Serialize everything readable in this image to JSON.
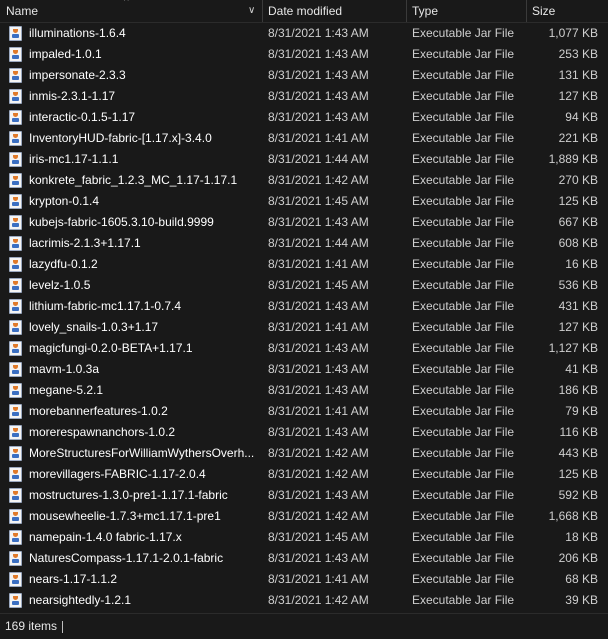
{
  "header": {
    "name_label": "Name",
    "date_label": "Date modified",
    "type_label": "Type",
    "size_label": "Size",
    "sort_icon": "^",
    "chevron_icon": "∨"
  },
  "files": [
    {
      "name": "illuminations-1.6.4",
      "date": "8/31/2021 1:43 AM",
      "type": "Executable Jar File",
      "size": "1,077 KB"
    },
    {
      "name": "impaled-1.0.1",
      "date": "8/31/2021 1:43 AM",
      "type": "Executable Jar File",
      "size": "253 KB"
    },
    {
      "name": "impersonate-2.3.3",
      "date": "8/31/2021 1:43 AM",
      "type": "Executable Jar File",
      "size": "131 KB"
    },
    {
      "name": "inmis-2.3.1-1.17",
      "date": "8/31/2021 1:43 AM",
      "type": "Executable Jar File",
      "size": "127 KB"
    },
    {
      "name": "interactic-0.1.5-1.17",
      "date": "8/31/2021 1:43 AM",
      "type": "Executable Jar File",
      "size": "94 KB"
    },
    {
      "name": "InventoryHUD-fabric-[1.17.x]-3.4.0",
      "date": "8/31/2021 1:41 AM",
      "type": "Executable Jar File",
      "size": "221 KB"
    },
    {
      "name": "iris-mc1.17-1.1.1",
      "date": "8/31/2021 1:44 AM",
      "type": "Executable Jar File",
      "size": "1,889 KB"
    },
    {
      "name": "konkrete_fabric_1.2.3_MC_1.17-1.17.1",
      "date": "8/31/2021 1:42 AM",
      "type": "Executable Jar File",
      "size": "270 KB"
    },
    {
      "name": "krypton-0.1.4",
      "date": "8/31/2021 1:45 AM",
      "type": "Executable Jar File",
      "size": "125 KB"
    },
    {
      "name": "kubejs-fabric-1605.3.10-build.9999",
      "date": "8/31/2021 1:43 AM",
      "type": "Executable Jar File",
      "size": "667 KB"
    },
    {
      "name": "lacrimis-2.1.3+1.17.1",
      "date": "8/31/2021 1:44 AM",
      "type": "Executable Jar File",
      "size": "608 KB"
    },
    {
      "name": "lazydfu-0.1.2",
      "date": "8/31/2021 1:41 AM",
      "type": "Executable Jar File",
      "size": "16 KB"
    },
    {
      "name": "levelz-1.0.5",
      "date": "8/31/2021 1:45 AM",
      "type": "Executable Jar File",
      "size": "536 KB"
    },
    {
      "name": "lithium-fabric-mc1.17.1-0.7.4",
      "date": "8/31/2021 1:43 AM",
      "type": "Executable Jar File",
      "size": "431 KB"
    },
    {
      "name": "lovely_snails-1.0.3+1.17",
      "date": "8/31/2021 1:41 AM",
      "type": "Executable Jar File",
      "size": "127 KB"
    },
    {
      "name": "magicfungi-0.2.0-BETA+1.17.1",
      "date": "8/31/2021 1:43 AM",
      "type": "Executable Jar File",
      "size": "1,127 KB"
    },
    {
      "name": "mavm-1.0.3a",
      "date": "8/31/2021 1:43 AM",
      "type": "Executable Jar File",
      "size": "41 KB"
    },
    {
      "name": "megane-5.2.1",
      "date": "8/31/2021 1:43 AM",
      "type": "Executable Jar File",
      "size": "186 KB"
    },
    {
      "name": "morebannerfeatures-1.0.2",
      "date": "8/31/2021 1:41 AM",
      "type": "Executable Jar File",
      "size": "79 KB"
    },
    {
      "name": "morerespawnanchors-1.0.2",
      "date": "8/31/2021 1:43 AM",
      "type": "Executable Jar File",
      "size": "116 KB"
    },
    {
      "name": "MoreStructuresForWilliamWythersOverh...",
      "date": "8/31/2021 1:42 AM",
      "type": "Executable Jar File",
      "size": "443 KB"
    },
    {
      "name": "morevillagers-FABRIC-1.17-2.0.4",
      "date": "8/31/2021 1:42 AM",
      "type": "Executable Jar File",
      "size": "125 KB"
    },
    {
      "name": "mostructures-1.3.0-pre1-1.17.1-fabric",
      "date": "8/31/2021 1:43 AM",
      "type": "Executable Jar File",
      "size": "592 KB"
    },
    {
      "name": "mousewheelie-1.7.3+mc1.17.1-pre1",
      "date": "8/31/2021 1:42 AM",
      "type": "Executable Jar File",
      "size": "1,668 KB"
    },
    {
      "name": "namepain-1.4.0 fabric-1.17.x",
      "date": "8/31/2021 1:45 AM",
      "type": "Executable Jar File",
      "size": "18 KB"
    },
    {
      "name": "NaturesCompass-1.17.1-2.0.1-fabric",
      "date": "8/31/2021 1:43 AM",
      "type": "Executable Jar File",
      "size": "206 KB"
    },
    {
      "name": "nears-1.17-1.1.2",
      "date": "8/31/2021 1:41 AM",
      "type": "Executable Jar File",
      "size": "68 KB"
    },
    {
      "name": "nearsightedly-1.2.1",
      "date": "8/31/2021 1:42 AM",
      "type": "Executable Jar File",
      "size": "39 KB"
    }
  ],
  "status": {
    "item_count": "169 items"
  },
  "icons": {
    "file_icon": "jar-file-icon"
  }
}
